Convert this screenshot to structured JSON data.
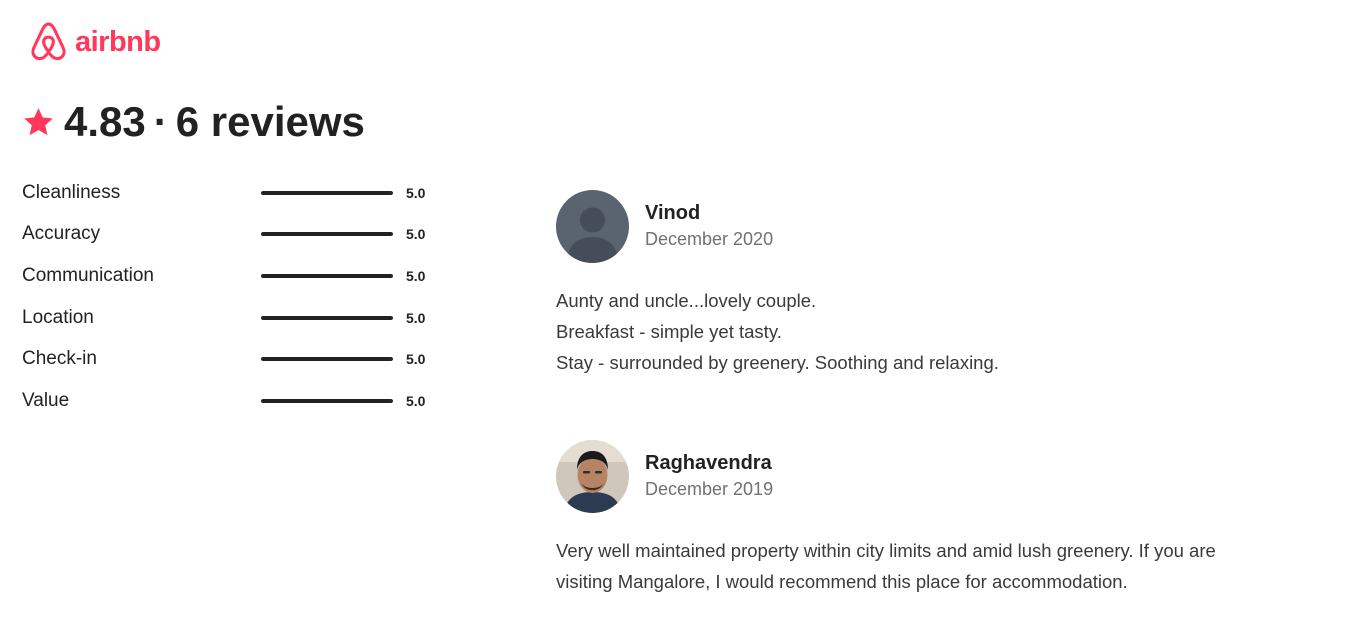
{
  "brand": {
    "name": "airbnb",
    "color": "#FF385C"
  },
  "summary": {
    "rating": "4.83",
    "separator": "·",
    "reviews_label": "6 reviews",
    "star_color": "#FF385C"
  },
  "categories": [
    {
      "label": "Cleanliness",
      "score": "5.0",
      "fraction": 1.0
    },
    {
      "label": "Accuracy",
      "score": "5.0",
      "fraction": 1.0
    },
    {
      "label": "Communication",
      "score": "5.0",
      "fraction": 1.0
    },
    {
      "label": "Location",
      "score": "5.0",
      "fraction": 1.0
    },
    {
      "label": "Check-in",
      "score": "5.0",
      "fraction": 1.0
    },
    {
      "label": "Value",
      "score": "5.0",
      "fraction": 1.0
    }
  ],
  "reviews": [
    {
      "name": "Vinod",
      "date": "December 2020",
      "avatar": "default-user-avatar",
      "lines": [
        "Aunty and uncle...lovely couple.",
        "Breakfast - simple yet tasty.",
        "Stay - surrounded by greenery. Soothing and relaxing."
      ]
    },
    {
      "name": "Raghavendra",
      "date": "December 2019",
      "avatar": "user-photo",
      "lines": [
        "Very well maintained property within city limits and amid lush greenery. If you are",
        "visiting Mangalore, I would recommend this place for accommodation."
      ]
    }
  ]
}
